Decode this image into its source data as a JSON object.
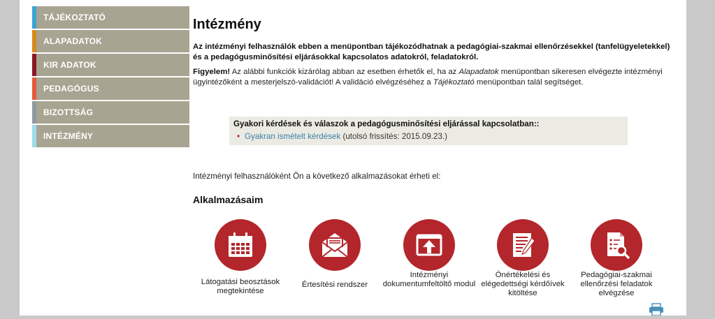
{
  "sidebar": {
    "items": [
      {
        "label": "TÁJÉKOZTATÓ",
        "accent": "#3ba4d6"
      },
      {
        "label": "ALAPADATOK",
        "accent": "#d98a1c"
      },
      {
        "label": "KIR ADATOK",
        "accent": "#8a1a22"
      },
      {
        "label": "PEDAGÓGUS",
        "accent": "#e25c3c"
      },
      {
        "label": "BIZOTTSÁG",
        "accent": "#8f9aa0"
      },
      {
        "label": "INTÉZMÉNY",
        "accent": "#9fdcec"
      }
    ]
  },
  "main": {
    "title": "Intézmény",
    "intro": "Az intézményi felhasználók ebben a menüpontban tájékozódhatnak a pedagógiai-szakmai ellenőrzésekkel (tanfelügyeletekkel) és a pedagógusminősítési eljárásokkal kapcsolatos adatokról, feladatokról.",
    "warning": {
      "bold": "Figyelem!",
      "part1": " Az alábbi funkciók kizárólag abban az esetben érhetők el, ha az ",
      "em1": "Alapadatok",
      "part2": " menüpontban sikeresen elvégezte intézményi ügyintézőként a mesterjelszó-validációt! A validáció elvégzéséhez a ",
      "em2": "Tájékoztató",
      "part3": " menüpontban talál segítséget."
    },
    "faq": {
      "heading": "Gyakori kérdések és válaszok a pedagógusminősítési eljárással kapcsolatban::",
      "bullet": "•",
      "link": "Gyakran ismételt kérdések",
      "suffix": " (utolsó frissítés: 2015.09.23.)"
    },
    "available_text": "Intézményi felhasználóként Ön a következő alkalmazásokat érheti el:",
    "apps_title": "Alkalmazásaim",
    "apps": [
      {
        "label": "Látogatási beosztások megtekintése",
        "icon": "calendar-icon"
      },
      {
        "label": "Értesítési rendszer",
        "icon": "envelope-icon"
      },
      {
        "label": "Intézményi dokumentumfeltöltő modul",
        "icon": "upload-icon"
      },
      {
        "label": "Önértékelési és elégedettségi kérdőívek kitöltése",
        "icon": "checklist-icon"
      },
      {
        "label": "Pedagógiai-szakmai ellenőrzési feladatok elvégzése",
        "icon": "document-search-icon"
      }
    ]
  },
  "colors": {
    "brand_red": "#b3262b",
    "sidebar_bg": "#a8a492",
    "link": "#3a7fa8"
  }
}
